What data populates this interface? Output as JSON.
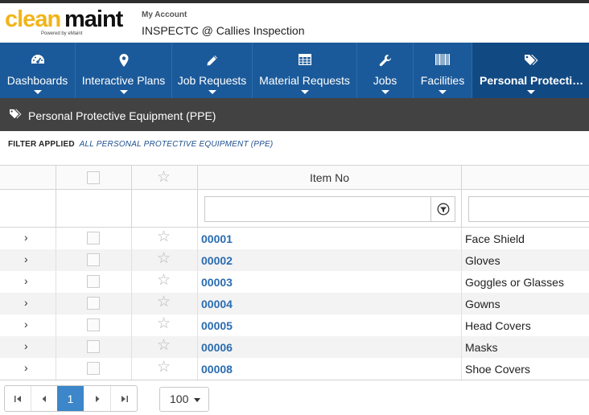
{
  "header": {
    "logo_part1": "clean",
    "logo_part2": "maint",
    "logo_powered": "Powered by eMaint",
    "account_label": "My Account",
    "account_name": "INSPECTC @ Callies Inspection"
  },
  "nav": {
    "items": [
      {
        "label": "Dashboards",
        "icon": "dashboard-icon"
      },
      {
        "label": "Interactive Plans",
        "icon": "map-marker-icon"
      },
      {
        "label": "Job Requests",
        "icon": "pencil-icon"
      },
      {
        "label": "Material Requests",
        "icon": "table-icon"
      },
      {
        "label": "Jobs",
        "icon": "wrench-icon"
      },
      {
        "label": "Facilities",
        "icon": "barcode-icon"
      },
      {
        "label": "Personal Protective ...",
        "icon": "tags-icon"
      }
    ]
  },
  "page": {
    "title": "Personal Protective Equipment (PPE)",
    "icon": "tags-icon"
  },
  "filter": {
    "label": "FILTER APPLIED",
    "value": "ALL PERSONAL PROTECTIVE EQUIPMENT (PPE)"
  },
  "grid": {
    "columns": {
      "item_no": "Item No",
      "description": ""
    },
    "filter_input_placeholder": "",
    "rows": [
      {
        "item_no": "00001",
        "description": "Face Shield"
      },
      {
        "item_no": "00002",
        "description": "Gloves"
      },
      {
        "item_no": "00003",
        "description": "Goggles or Glasses"
      },
      {
        "item_no": "00004",
        "description": "Gowns"
      },
      {
        "item_no": "00005",
        "description": "Head Covers"
      },
      {
        "item_no": "00006",
        "description": "Masks"
      },
      {
        "item_no": "00008",
        "description": "Shoe Covers"
      }
    ]
  },
  "pager": {
    "current_page": "1",
    "page_size": "100"
  },
  "colors": {
    "nav_bg": "#1b5a9a",
    "nav_active": "#114983",
    "pagebar_bg": "#424242",
    "link": "#2a6cb0",
    "pager_current": "#3c86c9",
    "logo_accent": "#f2b418"
  }
}
